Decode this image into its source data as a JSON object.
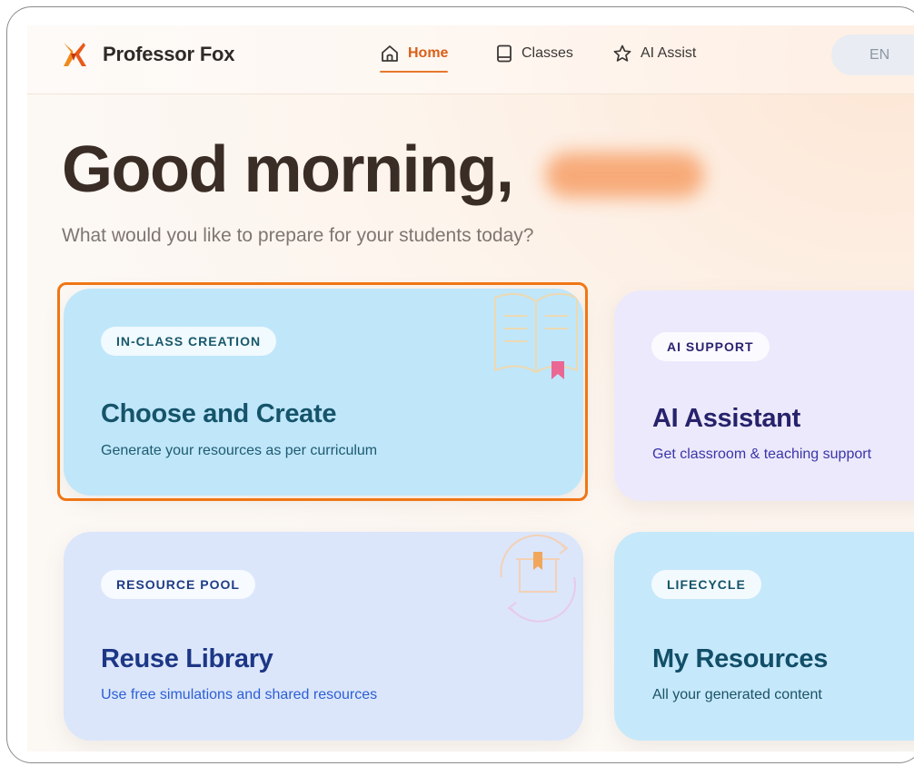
{
  "nav": {
    "brand": "Professor Fox",
    "items": [
      {
        "label": "Home",
        "icon": "home-icon",
        "active": true
      },
      {
        "label": "Classes",
        "icon": "book-icon",
        "active": false
      },
      {
        "label": "AI Assist",
        "icon": "star-icon",
        "active": false
      }
    ],
    "language": "EN"
  },
  "hero": {
    "greeting": "Good morning,",
    "subtitle": "What would you like to prepare for your students today?"
  },
  "cards": [
    {
      "badge": "IN-CLASS CREATION",
      "title": "Choose and Create",
      "description": "Generate your resources as per curriculum",
      "icon": "open-book-icon",
      "highlighted": true
    },
    {
      "badge": "AI SUPPORT",
      "title": "AI Assistant",
      "description": "Get classroom & teaching support",
      "highlighted": false
    },
    {
      "badge": "RESOURCE POOL",
      "title": "Reuse Library",
      "description": "Use free simulations and shared resources",
      "icon": "box-recycle-icon",
      "highlighted": false
    },
    {
      "badge": "LIFECYCLE",
      "title": "My Resources",
      "description": "All your generated content",
      "highlighted": false
    }
  ],
  "colors": {
    "accent": "#e8782d",
    "highlight_border": "#f07615",
    "heading": "#3a2d26"
  }
}
